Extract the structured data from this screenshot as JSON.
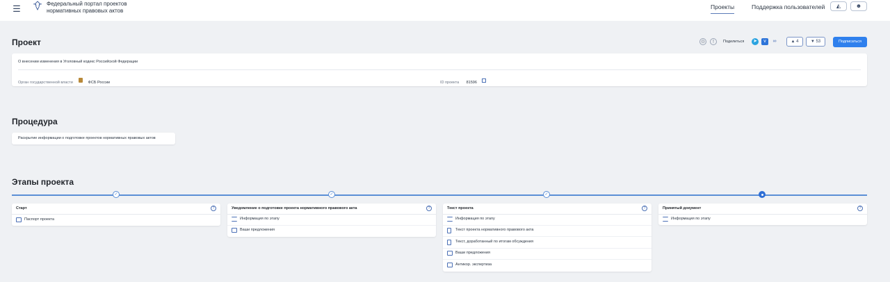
{
  "header": {
    "site_title": "Федеральный портал проектов\nнормативных правовых актов",
    "nav": [
      {
        "label": "Проекты",
        "active": true
      },
      {
        "label": "Поддержка пользователей",
        "active": false
      }
    ],
    "icons": [
      "menu-icon",
      "emblem-icon",
      "accessibility-icon",
      "profile-icon"
    ]
  },
  "project": {
    "section_title": "Проект",
    "description": "О внесении изменения в Уголовный кодекс Российской Федерации",
    "authority_label": "Орган государственной власти",
    "authority_value": "ФСБ России",
    "id_label": "ID проекта",
    "id_value": "81596",
    "share_label": "Поделиться",
    "likes": "4",
    "dislikes": "53",
    "subscribe_label": "Подписаться"
  },
  "procedure": {
    "section_title": "Процедура",
    "text": "Раскрытие информации о подготовке проектов нормативных правовых актов"
  },
  "stages": {
    "section_title": "Этапы проекта",
    "items": [
      {
        "title": "Старт",
        "status": "done",
        "links": [
          "Паспорт проекта"
        ]
      },
      {
        "title": "Уведомление о подготовке проекта нормативного правового акта",
        "status": "done",
        "links": [
          "Информация по этапу",
          "Ваши предложения"
        ]
      },
      {
        "title": "Текст проекта",
        "status": "done",
        "links": [
          "Информация по этапу",
          "Текст проекта нормативного правового акта",
          "Текст, доработанный по итогам обсуждения",
          "Ваши предложения",
          "Антикор. экспертиза"
        ]
      },
      {
        "title": "Принятый документ",
        "status": "current",
        "links": [
          "Информация по этапу"
        ]
      }
    ]
  },
  "colors": {
    "accent": "#2f80ed",
    "timeline": "#5b8fd6",
    "background": "#eff1f4"
  }
}
